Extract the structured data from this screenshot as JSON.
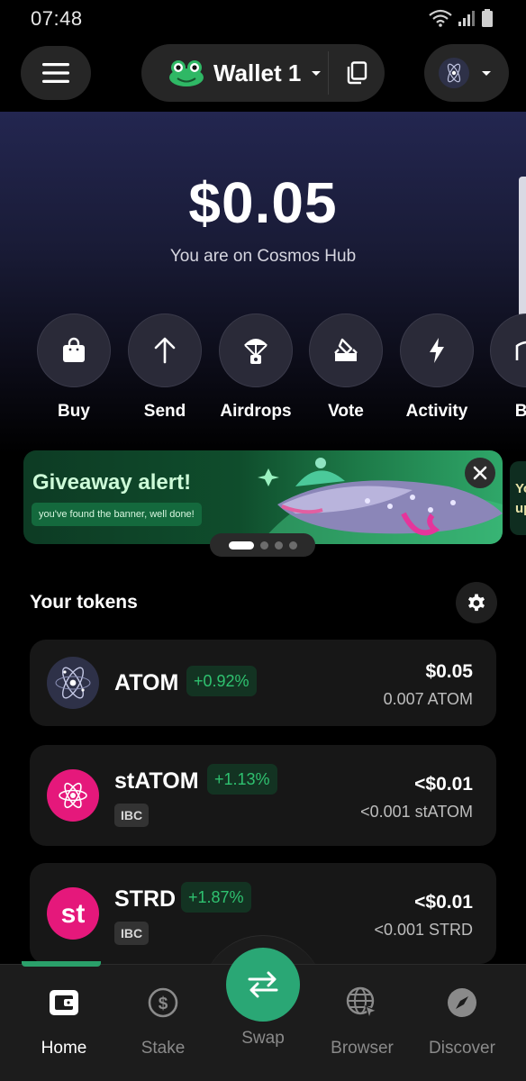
{
  "status_bar": {
    "time": "07:48"
  },
  "header": {
    "wallet_name": "Wallet 1",
    "icons": {
      "menu": "menu-icon",
      "frog": "frog-avatar-icon",
      "dropdown": "chevron-down-icon",
      "copy": "copy-icon",
      "chain": "cosmos-chain-icon"
    }
  },
  "hero": {
    "balance": "$0.05",
    "network_text": "You are on Cosmos Hub"
  },
  "actions": [
    {
      "label": "Buy",
      "icon": "shopping-bag-icon"
    },
    {
      "label": "Send",
      "icon": "arrow-up-icon"
    },
    {
      "label": "Airdrops",
      "icon": "parachute-icon"
    },
    {
      "label": "Vote",
      "icon": "ballot-box-icon"
    },
    {
      "label": "Activity",
      "icon": "lightning-icon"
    },
    {
      "label": "Bri",
      "icon": "bridge-icon"
    }
  ],
  "banner": {
    "title": "Giveaway alert!",
    "subtitle": "you've found the banner, well done!",
    "next_peek_line1": "Yo",
    "next_peek_line2": "up",
    "close_icon": "close-icon",
    "pagination": {
      "total": 4,
      "active": 1
    }
  },
  "tokens": {
    "section_title": "Your tokens",
    "settings_icon": "gear-icon",
    "items": [
      {
        "symbol": "ATOM",
        "change": "+0.92%",
        "usd": "$0.05",
        "amount": "0.007 ATOM",
        "badge": ""
      },
      {
        "symbol": "stATOM",
        "change": "+1.13%",
        "usd": "<$0.01",
        "amount": "<0.001 stATOM",
        "badge": "IBC"
      },
      {
        "symbol": "STRD",
        "change": "+1.87%",
        "usd": "<$0.01",
        "amount": "<0.001 STRD",
        "badge": "IBC"
      }
    ]
  },
  "bottom_nav": {
    "home": "Home",
    "stake": "Stake",
    "swap": "Swap",
    "browser": "Browser",
    "discover": "Discover"
  },
  "colors": {
    "accent_green": "#2aa775",
    "positive_change": "#2fc270",
    "stride_pink": "#e5187b",
    "hero_top": "#232650"
  }
}
